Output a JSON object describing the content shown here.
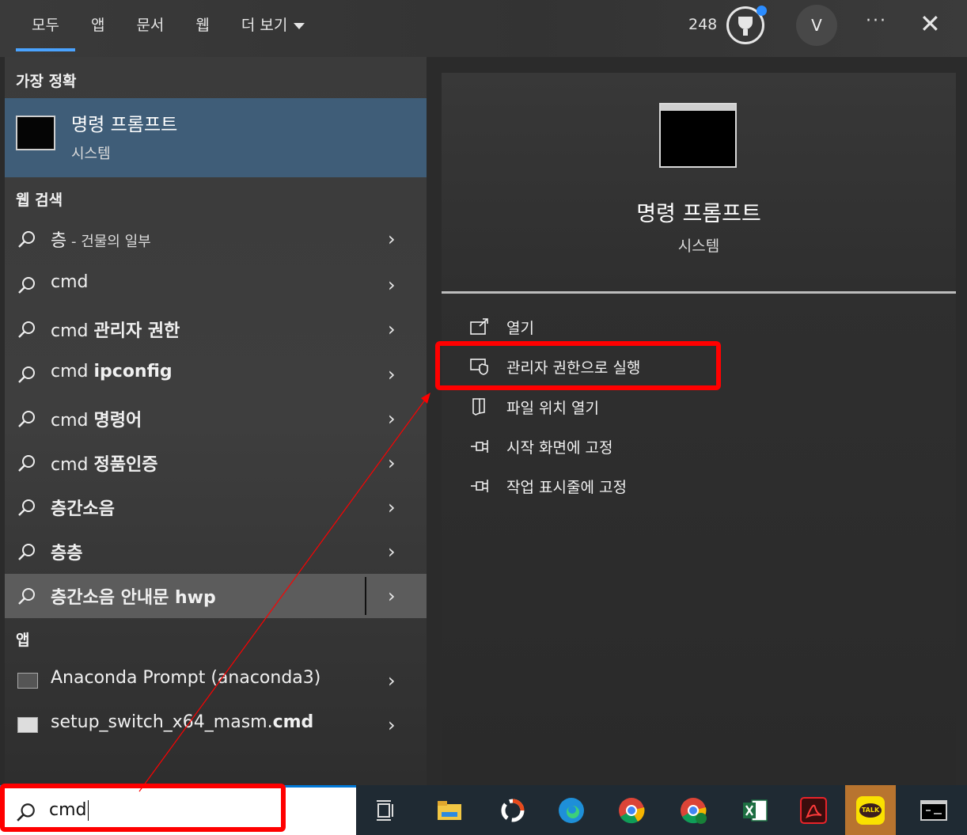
{
  "header": {
    "tabs": [
      {
        "label": "모두",
        "active": true
      },
      {
        "label": "앱"
      },
      {
        "label": "문서"
      },
      {
        "label": "웹"
      },
      {
        "label": "더 보기"
      }
    ],
    "points": "248",
    "avatar_initial": "V",
    "more_label": "···",
    "close_label": "✕"
  },
  "best_match": {
    "heading": "가장 정확",
    "title": "명령 프롬프트",
    "subtitle": "시스템",
    "icon": "terminal-icon"
  },
  "web_search": {
    "heading": "웹 검색",
    "items": [
      {
        "label": "층",
        "suffix": " - 건물의 일부"
      },
      {
        "label": "cmd"
      },
      {
        "label": "cmd ",
        "bold": "관리자 권한"
      },
      {
        "label": "cmd ",
        "bold": "ipconfig"
      },
      {
        "label": "cmd ",
        "bold": "명령어"
      },
      {
        "label": "cmd ",
        "bold": "정품인증"
      },
      {
        "label": "",
        "bold": "층간소음"
      },
      {
        "label": "",
        "bold": "층층"
      },
      {
        "label": "",
        "bold": "층간소음 안내문 hwp"
      }
    ]
  },
  "apps": {
    "heading": "앱",
    "items": [
      {
        "label": "Anaconda Prompt (anaconda3)"
      },
      {
        "label": "setup_switch_x64_masm.",
        "bold": "cmd"
      }
    ]
  },
  "details": {
    "title": "명령 프롬프트",
    "subtitle": "시스템",
    "actions": [
      {
        "label": "열기",
        "icon": "open-icon"
      },
      {
        "label": "관리자 권한으로 실행",
        "icon": "shield-icon"
      },
      {
        "label": "파일 위치 열기",
        "icon": "file-location-icon"
      },
      {
        "label": "시작 화면에 고정",
        "icon": "pin-icon"
      },
      {
        "label": "작업 표시줄에 고정",
        "icon": "pin-icon"
      }
    ]
  },
  "search": {
    "value": "cmd"
  },
  "taskbar": {
    "apps": [
      "task-view-icon",
      "file-explorer-icon",
      "app-icon",
      "edge-icon",
      "chrome-icon",
      "chrome-profile-icon",
      "excel-icon",
      "acrobat-icon",
      "kakaotalk-icon",
      "terminal-icon"
    ],
    "kakao_label": "TALK"
  },
  "colors": {
    "accent": "#0078d7",
    "selection": "#3f5d78",
    "annotation": "#ff0000"
  }
}
